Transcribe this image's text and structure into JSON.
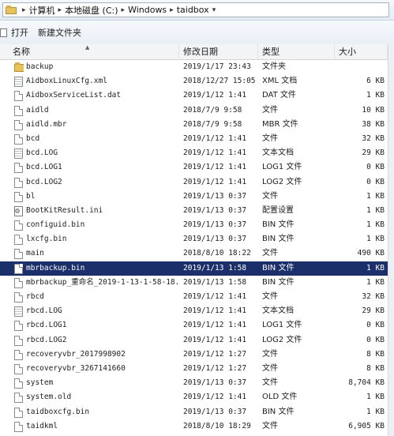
{
  "address": {
    "crumbs": [
      "计算机",
      "本地磁盘 (C:)",
      "Windows",
      "taidbox"
    ]
  },
  "toolbar": {
    "open_label": "打开",
    "new_folder_label": "新建文件夹"
  },
  "columns": {
    "name": "名称",
    "date": "修改日期",
    "type": "类型",
    "size": "大小"
  },
  "files": [
    {
      "icon": "folder-icon",
      "name": "backup",
      "date": "2019/1/17 23:43",
      "type": "文件夹",
      "size": ""
    },
    {
      "icon": "text-file-icon",
      "name": "AidboxLinuxCfg.xml",
      "date": "2018/12/27 15:05",
      "type": "XML 文档",
      "size": "6 KB"
    },
    {
      "icon": "file-icon",
      "name": "AidboxServiceList.dat",
      "date": "2019/1/12 1:41",
      "type": "DAT 文件",
      "size": "1 KB"
    },
    {
      "icon": "file-icon",
      "name": "aidld",
      "date": "2018/7/9 9:58",
      "type": "文件",
      "size": "10 KB"
    },
    {
      "icon": "file-icon",
      "name": "aidld.mbr",
      "date": "2018/7/9 9:58",
      "type": "MBR 文件",
      "size": "38 KB"
    },
    {
      "icon": "file-icon",
      "name": "bcd",
      "date": "2019/1/12 1:41",
      "type": "文件",
      "size": "32 KB"
    },
    {
      "icon": "text-file-icon",
      "name": "bcd.LOG",
      "date": "2019/1/12 1:41",
      "type": "文本文档",
      "size": "29 KB"
    },
    {
      "icon": "file-icon",
      "name": "bcd.LOG1",
      "date": "2019/1/12 1:41",
      "type": "LOG1 文件",
      "size": "0 KB"
    },
    {
      "icon": "file-icon",
      "name": "bcd.LOG2",
      "date": "2019/1/12 1:41",
      "type": "LOG2 文件",
      "size": "0 KB"
    },
    {
      "icon": "file-icon",
      "name": "bl",
      "date": "2019/1/13 0:37",
      "type": "文件",
      "size": "1 KB"
    },
    {
      "icon": "ini-file-icon",
      "name": "BootKitResult.ini",
      "date": "2019/1/13 0:37",
      "type": "配置设置",
      "size": "1 KB"
    },
    {
      "icon": "file-icon",
      "name": "configuid.bin",
      "date": "2019/1/13 0:37",
      "type": "BIN 文件",
      "size": "1 KB"
    },
    {
      "icon": "file-icon",
      "name": "lxcfg.bin",
      "date": "2019/1/13 0:37",
      "type": "BIN 文件",
      "size": "1 KB"
    },
    {
      "icon": "file-icon",
      "name": "main",
      "date": "2018/8/10 18:22",
      "type": "文件",
      "size": "490 KB"
    },
    {
      "icon": "file-icon",
      "name": "mbrbackup.bin",
      "date": "2019/1/13 1:58",
      "type": "BIN 文件",
      "size": "1 KB",
      "selected": true
    },
    {
      "icon": "file-icon",
      "name": "mbrbackup_重命名_2019-1-13-1-58-18...",
      "date": "2019/1/13 1:58",
      "type": "BIN 文件",
      "size": "1 KB"
    },
    {
      "icon": "file-icon",
      "name": "rbcd",
      "date": "2019/1/12 1:41",
      "type": "文件",
      "size": "32 KB"
    },
    {
      "icon": "text-file-icon",
      "name": "rbcd.LOG",
      "date": "2019/1/12 1:41",
      "type": "文本文档",
      "size": "29 KB"
    },
    {
      "icon": "file-icon",
      "name": "rbcd.LOG1",
      "date": "2019/1/12 1:41",
      "type": "LOG1 文件",
      "size": "0 KB"
    },
    {
      "icon": "file-icon",
      "name": "rbcd.LOG2",
      "date": "2019/1/12 1:41",
      "type": "LOG2 文件",
      "size": "0 KB"
    },
    {
      "icon": "file-icon",
      "name": "recoveryvbr_2017998902",
      "date": "2019/1/12 1:27",
      "type": "文件",
      "size": "8 KB"
    },
    {
      "icon": "file-icon",
      "name": "recoveryvbr_3267141660",
      "date": "2019/1/12 1:27",
      "type": "文件",
      "size": "8 KB"
    },
    {
      "icon": "file-icon",
      "name": "system",
      "date": "2019/1/13 0:37",
      "type": "文件",
      "size": "8,704 KB"
    },
    {
      "icon": "file-icon",
      "name": "system.old",
      "date": "2019/1/12 1:41",
      "type": "OLD 文件",
      "size": "1 KB"
    },
    {
      "icon": "file-icon",
      "name": "taidboxcfg.bin",
      "date": "2019/1/13 0:37",
      "type": "BIN 文件",
      "size": "1 KB"
    },
    {
      "icon": "file-icon",
      "name": "taidkml",
      "date": "2018/8/10 18:29",
      "type": "文件",
      "size": "6,905 KB"
    }
  ]
}
